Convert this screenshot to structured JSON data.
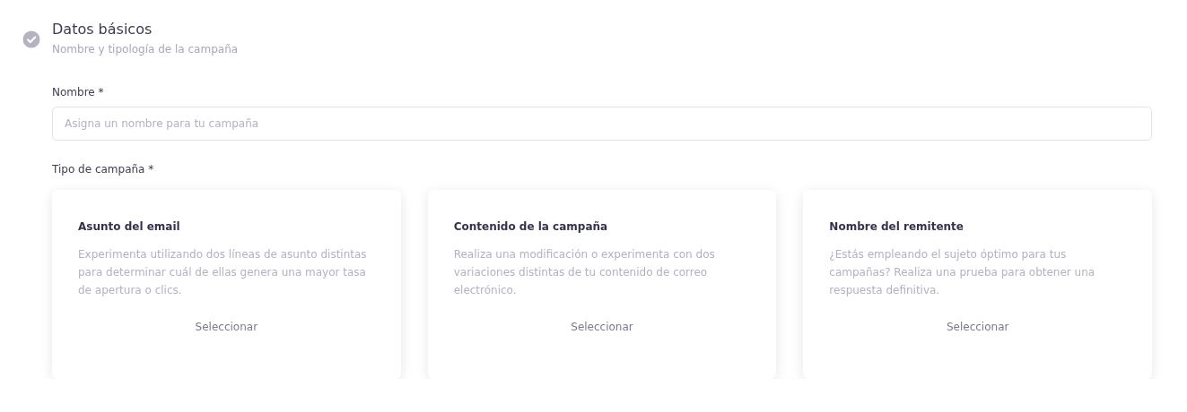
{
  "step": {
    "title": "Datos básicos",
    "subtitle": "Nombre y tipología de la campaña",
    "completed": true
  },
  "name_field": {
    "label": "Nombre *",
    "placeholder": "Asigna un nombre para tu campaña"
  },
  "type_label": "Tipo de campaña *",
  "cards": [
    {
      "title": "Asunto del email",
      "description": "Experimenta utilizando dos líneas de asunto distintas para determinar cuál de ellas genera una mayor tasa de apertura o clics.",
      "action": "Seleccionar"
    },
    {
      "title": "Contenido de la campaña",
      "description": "Realiza una modificación o experimenta con dos variaciones distintas de tu contenido de correo electrónico.",
      "action": "Seleccionar"
    },
    {
      "title": "Nombre del remitente",
      "description": "¿Estás empleando el sujeto óptimo para tus campañas? Realiza una prueba para obtener una respuesta definitiva.",
      "action": "Seleccionar"
    }
  ]
}
